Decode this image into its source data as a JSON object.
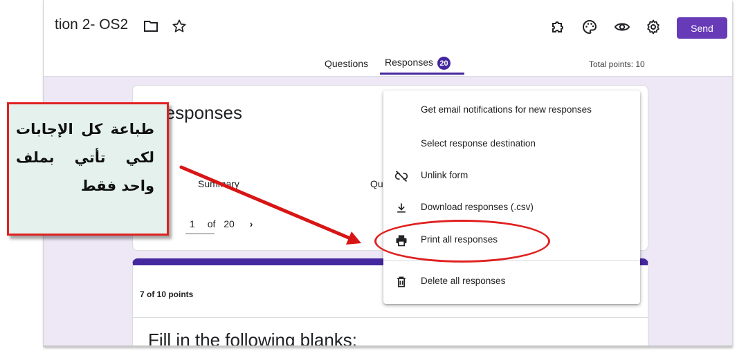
{
  "header": {
    "title": "tion 2- OS2",
    "send_label": "Send",
    "icons": [
      "folder-icon",
      "star-icon",
      "addon-puzzle-icon",
      "palette-icon",
      "preview-eye-icon",
      "settings-gear-icon"
    ]
  },
  "tabs": [
    {
      "label": "Questions"
    },
    {
      "label": "Responses",
      "badge": "20",
      "selected": true
    }
  ],
  "total_points": "Total points: 10",
  "responses_card": {
    "title": "responses",
    "tabs": [
      "Summary",
      "Qu"
    ],
    "pager": {
      "current": "1",
      "of_label": "of",
      "total": "20",
      "next_icon": "chevron-right-icon"
    }
  },
  "score_card": {
    "score": "7 of 10 points",
    "question": "Fill in the following blanks:"
  },
  "menu": {
    "items": [
      {
        "label": "Get email notifications for new responses",
        "icon": ""
      },
      {
        "label": "Select response destination",
        "icon": ""
      },
      {
        "label": "Unlink form",
        "icon": "unlink-icon"
      },
      {
        "label": "Download responses (.csv)",
        "icon": "download-icon"
      },
      {
        "label": "Print all responses",
        "icon": "print-icon",
        "highlighted": true
      },
      {
        "label": "Delete all responses",
        "icon": "trash-icon"
      }
    ]
  },
  "annotation": {
    "lines": [
      "طباعة كل الإجابات",
      "لكي تأتي بملف",
      "واحد فقط"
    ]
  },
  "colors": {
    "accent": "#673ab7",
    "badge": "#4527a0",
    "background": "#ede7f6",
    "annotation_red": "#e02020",
    "annotation_fill": "#e4f1ec"
  }
}
